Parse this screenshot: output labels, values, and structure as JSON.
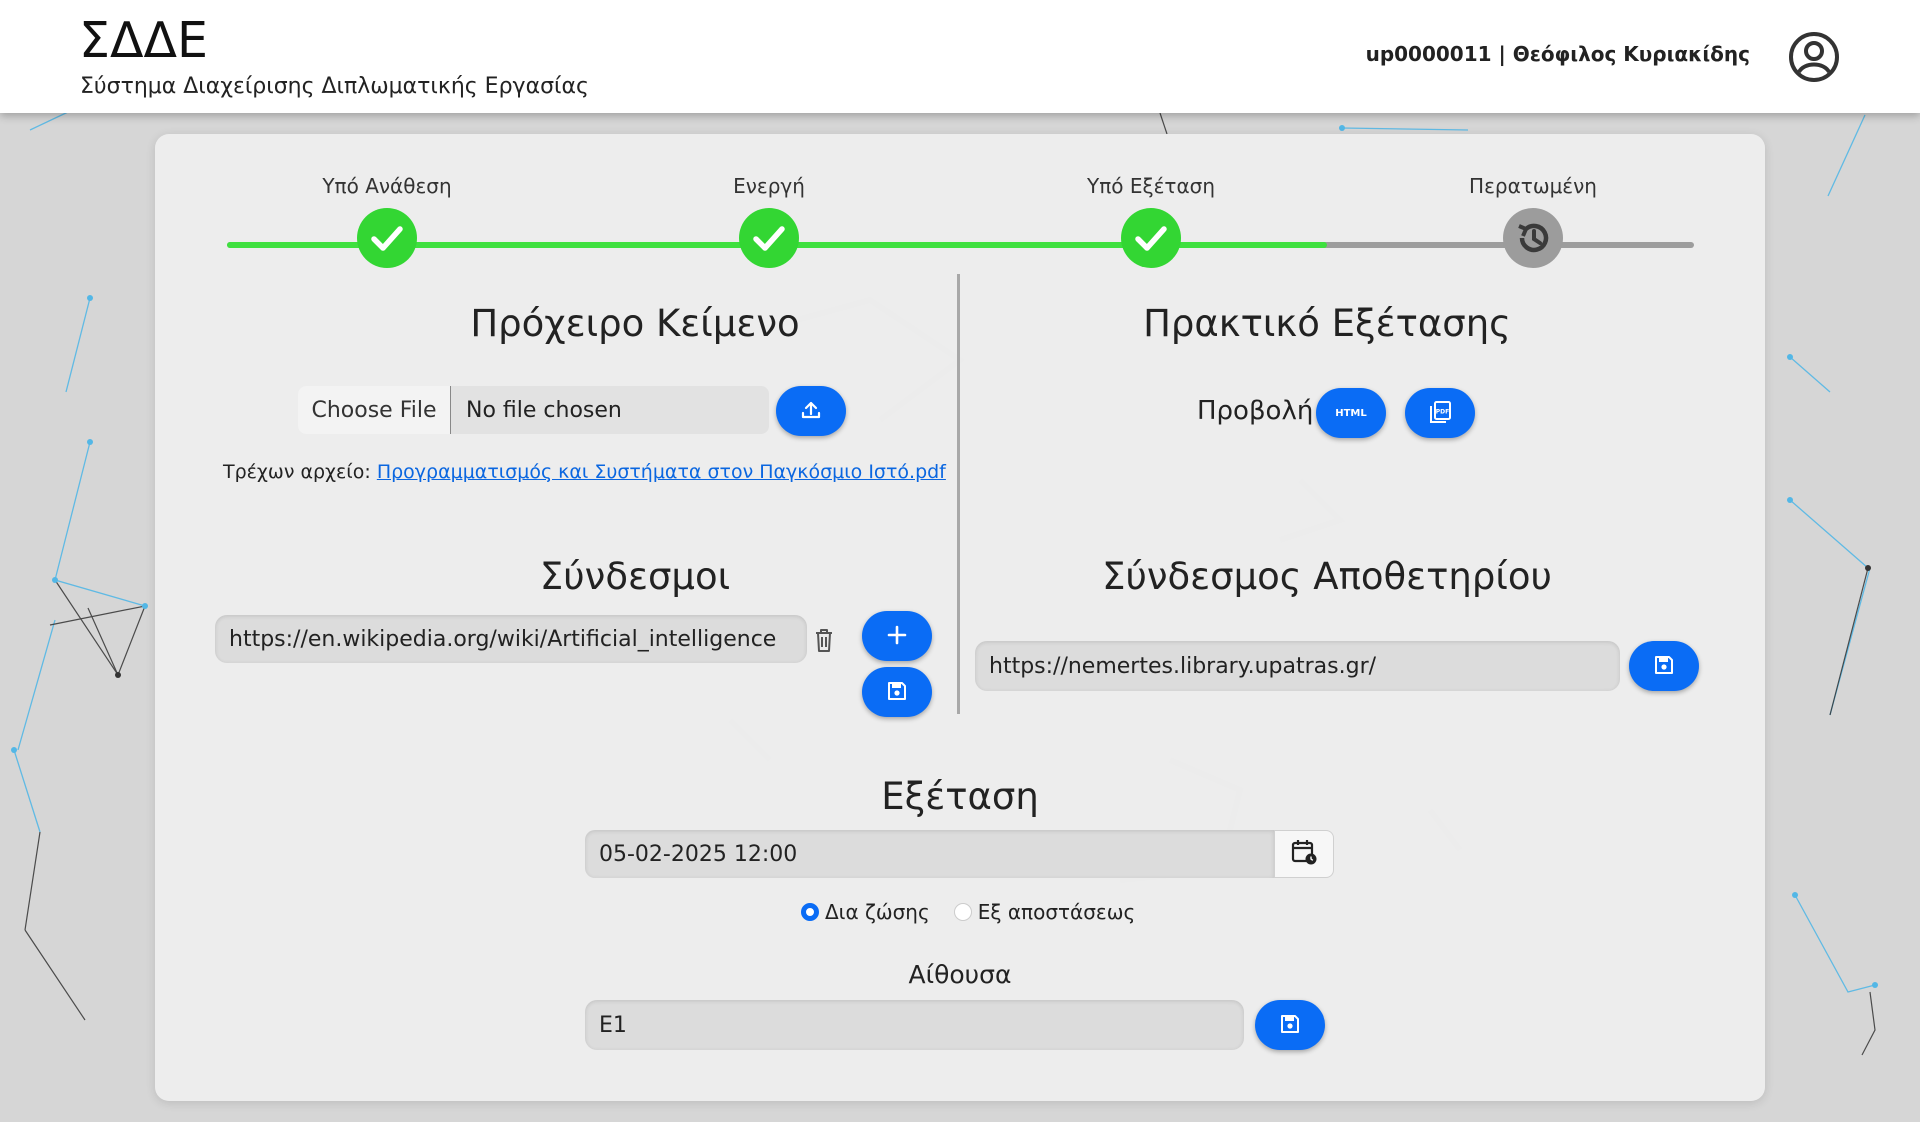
{
  "header": {
    "title": "ΣΔΔΕ",
    "subtitle": "Σύστημα Διαχείρισης Διπλωματικής Εργασίας",
    "user": "up0000011 | Θεόφιλος Κυριακίδης",
    "avatar_icon": "user-circle-icon"
  },
  "stepper": {
    "steps": [
      {
        "label": "Υπό Ανάθεση",
        "status": "done",
        "icon": "check-icon"
      },
      {
        "label": "Ενεργή",
        "status": "done",
        "icon": "check-icon"
      },
      {
        "label": "Υπό Εξέταση",
        "status": "done",
        "icon": "check-icon"
      },
      {
        "label": "Περατωμένη",
        "status": "pending",
        "icon": "history-icon"
      }
    ],
    "progress_fraction": 0.75,
    "colors": {
      "done": "#33d633",
      "pending": "#9c9c9c"
    }
  },
  "draft": {
    "title": "Πρόχειρο Κείμενο",
    "choose_file_label": "Choose File",
    "no_file_label": "No file chosen",
    "upload_icon": "upload-icon",
    "current_file_label": "Τρέχων αρχείο:",
    "current_file_link": "Προγραμματισμός και Συστήματα στον Παγκόσμιο Ιστό.pdf"
  },
  "report": {
    "title": "Πρακτικό Εξέτασης",
    "view_label": "Προβολή",
    "html_icon": "html-file-icon",
    "pdf_icon": "pdf-file-icon"
  },
  "links": {
    "title": "Σύνδεσμοι",
    "items": [
      "https://en.wikipedia.org/wiki/Artificial_intelligence"
    ],
    "delete_icon": "trash-icon",
    "add_icon": "plus-icon",
    "save_icon": "save-icon"
  },
  "repository": {
    "title": "Σύνδεσμος Αποθετηρίου",
    "value": "https://nemertes.library.upatras.gr/"
  },
  "exam": {
    "title": "Εξέταση",
    "datetime": "05-02-2025 12:00",
    "calendar_icon": "calendar-clock-icon",
    "mode_options": [
      "Δια ζώσης",
      "Εξ αποστάσεως"
    ],
    "mode_selected": "Δια ζώσης",
    "room_label": "Αίθουσα",
    "room_value": "E1"
  },
  "colors": {
    "accent": "#0a6cf5",
    "success": "#33d633",
    "link": "#0a66e0"
  }
}
